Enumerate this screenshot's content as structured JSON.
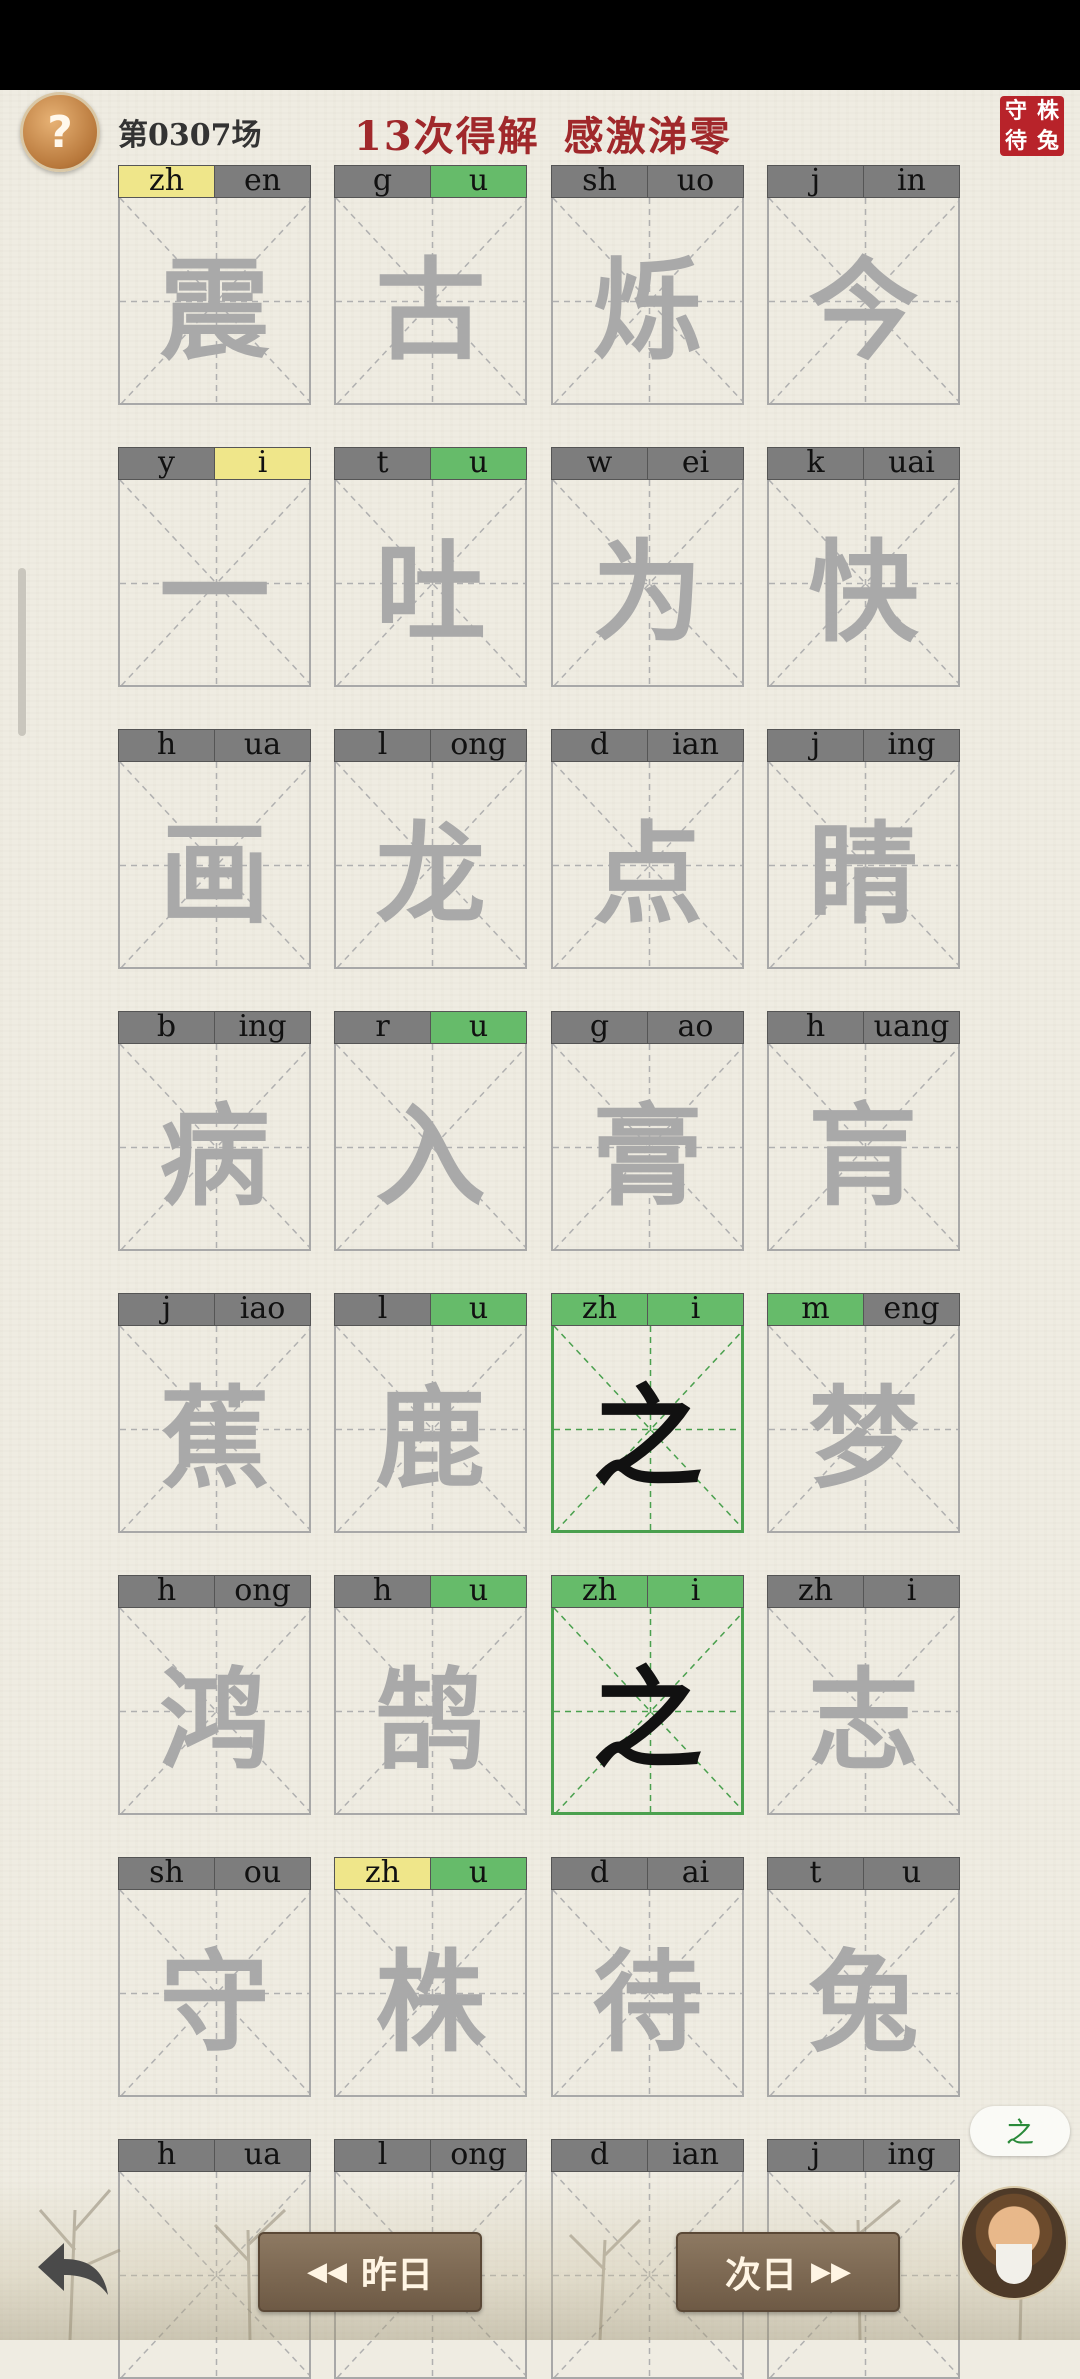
{
  "header": {
    "help_icon": "question-mark",
    "level": "第0307场",
    "title_attempts": "13次得解",
    "title_idiom": "感激涕零",
    "seal_chars": [
      "株",
      "守",
      "兔",
      "待"
    ]
  },
  "grid": {
    "rows": [
      [
        {
          "c": "震",
          "py": [
            {
              "t": "zh",
              "s": "y"
            },
            {
              "t": "en",
              "s": ""
            }
          ]
        },
        {
          "c": "古",
          "py": [
            {
              "t": "g",
              "s": ""
            },
            {
              "t": "u",
              "s": "g"
            }
          ]
        },
        {
          "c": "烁",
          "py": [
            {
              "t": "sh",
              "s": ""
            },
            {
              "t": "uo",
              "s": ""
            }
          ]
        },
        {
          "c": "今",
          "py": [
            {
              "t": "j",
              "s": ""
            },
            {
              "t": "in",
              "s": ""
            }
          ]
        }
      ],
      [
        {
          "c": "一",
          "py": [
            {
              "t": "y",
              "s": ""
            },
            {
              "t": "i",
              "s": "y"
            }
          ]
        },
        {
          "c": "吐",
          "py": [
            {
              "t": "t",
              "s": ""
            },
            {
              "t": "u",
              "s": "g"
            }
          ]
        },
        {
          "c": "为",
          "py": [
            {
              "t": "w",
              "s": ""
            },
            {
              "t": "ei",
              "s": ""
            }
          ]
        },
        {
          "c": "快",
          "py": [
            {
              "t": "k",
              "s": ""
            },
            {
              "t": "uai",
              "s": ""
            }
          ]
        }
      ],
      [
        {
          "c": "画",
          "py": [
            {
              "t": "h",
              "s": ""
            },
            {
              "t": "ua",
              "s": ""
            }
          ]
        },
        {
          "c": "龙",
          "py": [
            {
              "t": "l",
              "s": ""
            },
            {
              "t": "ong",
              "s": ""
            }
          ]
        },
        {
          "c": "点",
          "py": [
            {
              "t": "d",
              "s": ""
            },
            {
              "t": "ian",
              "s": ""
            }
          ]
        },
        {
          "c": "睛",
          "py": [
            {
              "t": "j",
              "s": ""
            },
            {
              "t": "ing",
              "s": ""
            }
          ]
        }
      ],
      [
        {
          "c": "病",
          "py": [
            {
              "t": "b",
              "s": ""
            },
            {
              "t": "ing",
              "s": ""
            }
          ]
        },
        {
          "c": "入",
          "py": [
            {
              "t": "r",
              "s": ""
            },
            {
              "t": "u",
              "s": "g"
            }
          ]
        },
        {
          "c": "膏",
          "py": [
            {
              "t": "g",
              "s": ""
            },
            {
              "t": "ao",
              "s": ""
            }
          ]
        },
        {
          "c": "肓",
          "py": [
            {
              "t": "h",
              "s": ""
            },
            {
              "t": "uang",
              "s": ""
            }
          ]
        }
      ],
      [
        {
          "c": "蕉",
          "py": [
            {
              "t": "j",
              "s": ""
            },
            {
              "t": "iao",
              "s": ""
            }
          ]
        },
        {
          "c": "鹿",
          "py": [
            {
              "t": "l",
              "s": ""
            },
            {
              "t": "u",
              "s": "g"
            }
          ]
        },
        {
          "c": "之",
          "done": true,
          "py": [
            {
              "t": "zh",
              "s": "g"
            },
            {
              "t": "i",
              "s": "g"
            }
          ]
        },
        {
          "c": "梦",
          "py": [
            {
              "t": "m",
              "s": "g"
            },
            {
              "t": "eng",
              "s": ""
            }
          ]
        }
      ],
      [
        {
          "c": "鸿",
          "py": [
            {
              "t": "h",
              "s": ""
            },
            {
              "t": "ong",
              "s": ""
            }
          ]
        },
        {
          "c": "鹄",
          "py": [
            {
              "t": "h",
              "s": ""
            },
            {
              "t": "u",
              "s": "g"
            }
          ]
        },
        {
          "c": "之",
          "done": true,
          "py": [
            {
              "t": "zh",
              "s": "g"
            },
            {
              "t": "i",
              "s": "g"
            }
          ]
        },
        {
          "c": "志",
          "py": [
            {
              "t": "zh",
              "s": ""
            },
            {
              "t": "i",
              "s": ""
            }
          ]
        }
      ],
      [
        {
          "c": "守",
          "py": [
            {
              "t": "sh",
              "s": ""
            },
            {
              "t": "ou",
              "s": ""
            }
          ]
        },
        {
          "c": "株",
          "py": [
            {
              "t": "zh",
              "s": "y"
            },
            {
              "t": "u",
              "s": "g"
            }
          ]
        },
        {
          "c": "待",
          "py": [
            {
              "t": "d",
              "s": ""
            },
            {
              "t": "ai",
              "s": ""
            }
          ]
        },
        {
          "c": "兔",
          "py": [
            {
              "t": "t",
              "s": ""
            },
            {
              "t": "u",
              "s": ""
            }
          ]
        }
      ],
      [
        {
          "c": "",
          "py": [
            {
              "t": "h",
              "s": ""
            },
            {
              "t": "ua",
              "s": ""
            }
          ]
        },
        {
          "c": "",
          "py": [
            {
              "t": "l",
              "s": ""
            },
            {
              "t": "ong",
              "s": ""
            }
          ]
        },
        {
          "c": "",
          "py": [
            {
              "t": "d",
              "s": ""
            },
            {
              "t": "ian",
              "s": ""
            }
          ]
        },
        {
          "c": "",
          "py": [
            {
              "t": "j",
              "s": ""
            },
            {
              "t": "ing",
              "s": ""
            }
          ]
        }
      ]
    ]
  },
  "footer": {
    "back_icon": "back-arrow",
    "prev_label": "昨日",
    "prev_icon": "double-left-arrow",
    "next_label": "次日",
    "next_icon": "double-right-arrow",
    "bubble_text": "之",
    "avatar_icon": "scholar-portrait"
  },
  "colors": {
    "correct": "#66bb6a",
    "present": "#efe68a",
    "absent": "#7d7d7d",
    "title": "#a0282b",
    "seal": "#b8232a"
  }
}
